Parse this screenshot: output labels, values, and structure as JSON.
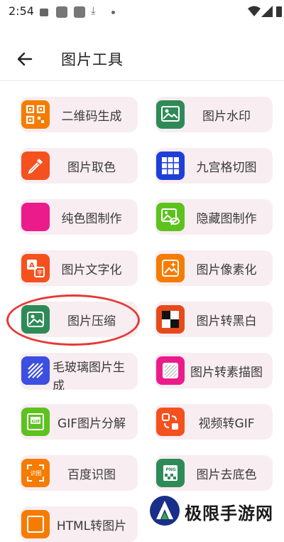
{
  "status_bar": {
    "time": "2:54"
  },
  "header": {
    "title": "图片工具"
  },
  "tools": [
    {
      "label": "二维码生成",
      "icon": "qr-code-icon",
      "color": "#f57c00"
    },
    {
      "label": "图片水印",
      "icon": "image-watermark-icon",
      "color": "#2e8b57"
    },
    {
      "label": "图片取色",
      "icon": "eyedropper-icon",
      "color": "#f4511e"
    },
    {
      "label": "九宫格切图",
      "icon": "grid-icon",
      "color": "#1e3fd8"
    },
    {
      "label": "纯色图制作",
      "icon": "solid-color-icon",
      "color": "#ec1b8c"
    },
    {
      "label": "隐藏图制作",
      "icon": "hidden-image-icon",
      "color": "#5dc21e"
    },
    {
      "label": "图片文字化",
      "icon": "text-image-icon",
      "color": "#f4511e"
    },
    {
      "label": "图片像素化",
      "icon": "pixelate-icon",
      "color": "#f57c00"
    },
    {
      "label": "图片压缩",
      "icon": "compress-icon",
      "color": "#2e8b57"
    },
    {
      "label": "图片转黑白",
      "icon": "black-white-icon",
      "color": "#e64a19"
    },
    {
      "label": "毛玻璃图片生成",
      "icon": "frosted-glass-icon",
      "color": "#3d4fe0"
    },
    {
      "label": "图片转素描图",
      "icon": "sketch-icon",
      "color": "#ec1b8c"
    },
    {
      "label": "GIF图片分解",
      "icon": "gif-icon",
      "color": "#5dc21e"
    },
    {
      "label": "视频转GIF",
      "icon": "video-to-gif-icon",
      "color": "#f4511e"
    },
    {
      "label": "百度识图",
      "icon": "recognize-icon",
      "color": "#f57c00"
    },
    {
      "label": "图片去底色",
      "icon": "png-background-icon",
      "color": "#2e8b57"
    },
    {
      "label": "HTML转图片",
      "icon": "html-icon",
      "color": "#f57c00"
    }
  ],
  "watermark": {
    "text": "极限手游网"
  }
}
